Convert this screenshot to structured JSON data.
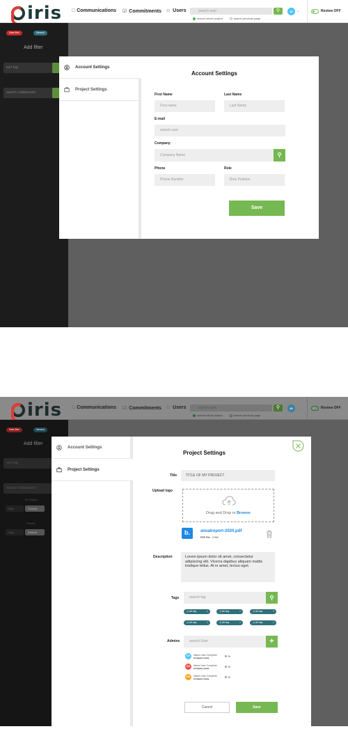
{
  "header": {
    "logo": "iris",
    "nav": [
      {
        "icon": "chat-icon",
        "label": "Communications"
      },
      {
        "icon": "checkbox-icon",
        "label": "Commitments"
      },
      {
        "icon": "user-icon",
        "label": "Users"
      }
    ],
    "search_placeholder": "search user",
    "radio_options": [
      "search whole project",
      "search previous page"
    ],
    "avatar_initials": "JD",
    "review_label": "Review OFF"
  },
  "frame1": {
    "sidebar": {
      "chips": [
        "Date filter",
        "Newest"
      ],
      "add_filter": "Add filter",
      "tag_placeholder": "sort tag",
      "collaborator_placeholder": "search collaborator"
    },
    "modal": {
      "tabs": [
        {
          "icon": "user-circle-icon",
          "label": "Account Settings"
        },
        {
          "icon": "briefcase-icon",
          "label": "Project Settings"
        }
      ],
      "title": "Account Settings",
      "fields": {
        "first_name": {
          "label": "First Name",
          "placeholder": "First name"
        },
        "last_name": {
          "label": "Last Name",
          "placeholder": "Last Name"
        },
        "email": {
          "label": "E-mail",
          "placeholder": "search user"
        },
        "company": {
          "label": "Company",
          "placeholder": "Company Name"
        },
        "phone": {
          "label": "Phone",
          "placeholder": "Phone Number"
        },
        "role": {
          "label": "Role",
          "placeholder": "Role Position"
        }
      },
      "save_label": "Save"
    }
  },
  "frame2": {
    "sidebar": {
      "chips": [
        "Date filter",
        "Newest"
      ],
      "add_filter": "Add filter",
      "tag_placeholder": "sort tag",
      "collaborator_placeholder": "search collaborator",
      "by_label": "By Degree",
      "by_options": [
        "Low",
        "Closest"
      ],
      "priority_label": "Priority",
      "priority_options": [
        "Low",
        "Default"
      ]
    },
    "modal": {
      "tabs": [
        {
          "icon": "user-circle-icon",
          "label": "Account Settings"
        },
        {
          "icon": "briefcase-icon",
          "label": "Project Settings"
        }
      ],
      "title": "Project Settings",
      "title_label": "Title",
      "title_value": "TITLE OF MY PROJECT",
      "upload_label": "Upload logo",
      "upload_text": "Drag and Drop or ",
      "upload_link": "Browse",
      "file": {
        "letter": "b.",
        "name": "anualreport-2020.pdf",
        "type": "PDF File",
        "size": "123kB"
      },
      "description_label": "Description",
      "description_value": "Lorem ipsum dolor sit amet, consectetur adipiscing elit. Viverra dapibus aliquam mattis tristique tellus. At in amet, lectus eget.",
      "tags_label": "Tags",
      "tags_placeholder": "search tag",
      "tags": [
        "All day",
        "All day",
        "All day",
        "All day",
        "All day",
        "All day"
      ],
      "admins_label": "Admins",
      "admins_placeholder": "search User",
      "admins": [
        {
          "initials": "CH",
          "name": "Name User Complete",
          "company": "Company name",
          "pct": "%",
          "color": "#4fc3f7"
        },
        {
          "initials": "CH",
          "name": "Name User Complete",
          "company": "Company name",
          "pct": "%",
          "color": "#ef5350"
        },
        {
          "initials": "CH",
          "name": "Name User Complete",
          "company": "Company name",
          "pct": "%",
          "color": "#ffa726"
        }
      ],
      "cancel_label": "Cancel",
      "save_label": "Save"
    }
  },
  "colors": {
    "accent": "#76b852",
    "teal": "#2f6f7a",
    "link": "#1e88e5"
  }
}
